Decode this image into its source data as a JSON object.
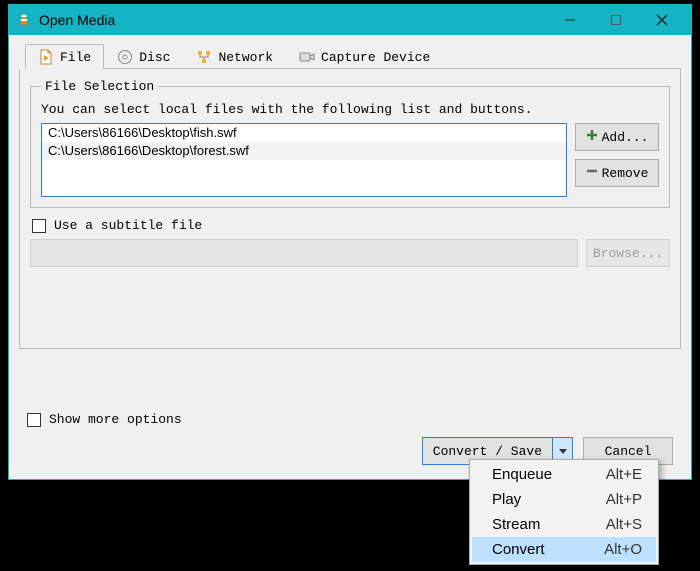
{
  "window": {
    "title": "Open Media"
  },
  "tabs": {
    "file": "File",
    "disc": "Disc",
    "network": "Network",
    "capture": "Capture Device"
  },
  "fileSelection": {
    "legend": "File Selection",
    "hint": "You can select local files with the following list and buttons.",
    "items": [
      "C:\\Users\\86166\\Desktop\\fish.swf",
      "C:\\Users\\86166\\Desktop\\forest.swf"
    ],
    "addLabel": "Add...",
    "removeLabel": "Remove"
  },
  "subtitle": {
    "checkboxLabel": "Use a subtitle file",
    "browseLabel": "Browse..."
  },
  "moreOptions": "Show more options",
  "bottom": {
    "convertSave": "Convert / Save",
    "cancel": "Cancel"
  },
  "menu": {
    "items": [
      {
        "label": "Enqueue",
        "shortcut": "Alt+E"
      },
      {
        "label": "Play",
        "shortcut": "Alt+P"
      },
      {
        "label": "Stream",
        "shortcut": "Alt+S"
      },
      {
        "label": "Convert",
        "shortcut": "Alt+O"
      }
    ],
    "hoverIndex": 3
  }
}
